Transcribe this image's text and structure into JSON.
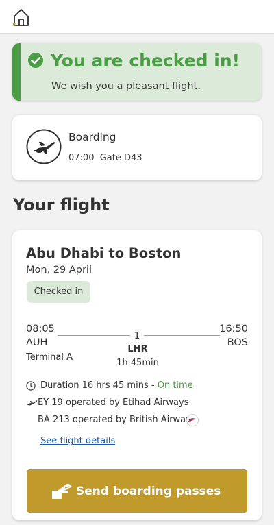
{
  "icons": {
    "home": "home-icon",
    "check": "check-circle-icon",
    "boarding": "plane-takeoff-icon",
    "clock": "clock-icon",
    "plane": "plane-icon",
    "airline_logo": "british-airways-logo-icon",
    "ticket": "ticket-icon"
  },
  "colors": {
    "accent_green": "#4a9d45",
    "banner_bg": "#dcebd9",
    "gold": "#c09b2b",
    "link_blue": "#1a5aa8"
  },
  "banner": {
    "title": "You are checked in!",
    "subtitle": "We wish you a pleasant flight."
  },
  "boarding": {
    "title": "Boarding",
    "time": "07:00",
    "gate": "Gate D43"
  },
  "section_heading": "Your flight",
  "flight": {
    "route": "Abu Dhabi to Boston",
    "date": "Mon, 29 April",
    "status": "Checked in",
    "departure": {
      "time": "08:05",
      "code": "AUH",
      "terminal": "Terminal A"
    },
    "arrival": {
      "time": "16:50",
      "code": "BOS"
    },
    "stop": {
      "count": "1",
      "code": "LHR",
      "layover": "1h 45min"
    },
    "duration": "Duration 16 hrs 45 mins",
    "separator": "-",
    "punctuality": "On time",
    "segments": [
      "EY 19 operated by Etihad Airways",
      "BA 213 operated by British Airways"
    ],
    "details_link": "See flight details"
  },
  "send_button_label": "Send boarding passes"
}
